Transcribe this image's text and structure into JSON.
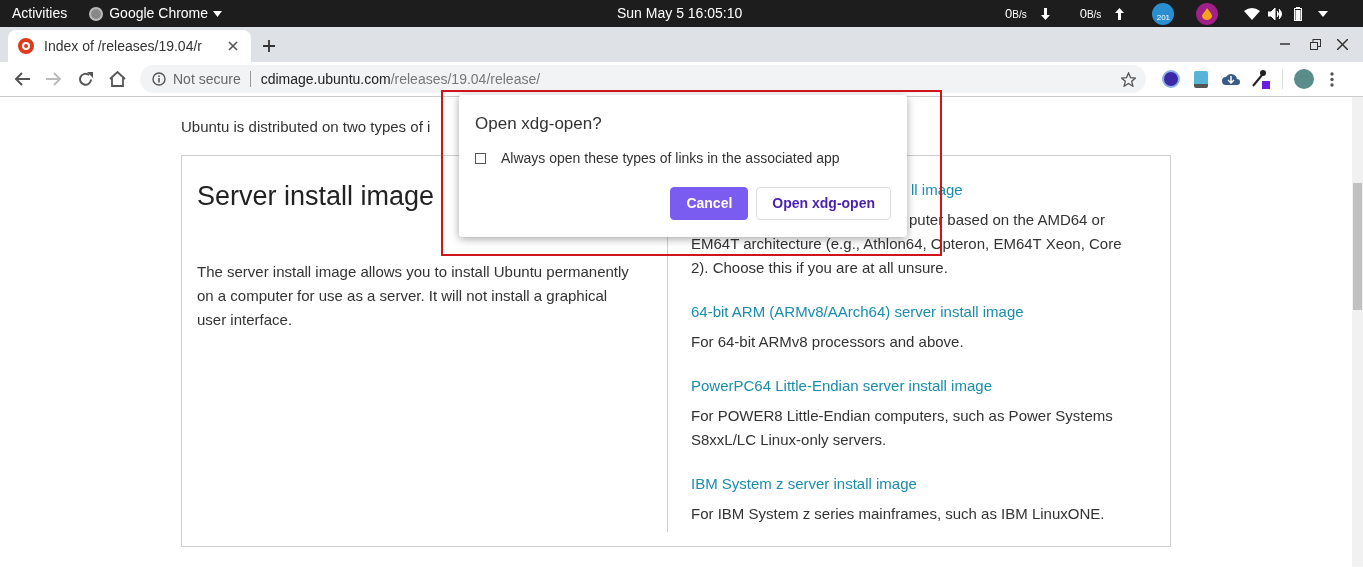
{
  "top_bar": {
    "activities": "Activities",
    "app_menu": "Google Chrome",
    "clock": "Sun May 5  16:05:10",
    "net_down": {
      "value": "0",
      "unit": "B/s"
    },
    "net_up": {
      "value": "0",
      "unit": "B/s"
    },
    "badge": "201"
  },
  "browser": {
    "tab": {
      "title": "Index of /releases/19.04/r",
      "selected": true
    },
    "address": {
      "security": "Not secure",
      "host": "cdimage.ubuntu.com",
      "path": "/releases/19.04/release/"
    }
  },
  "page": {
    "intro": "Ubuntu is distributed on two types of i",
    "card": {
      "heading": "Server install image",
      "description": "The server install image allows you to install Ubuntu permanently on a computer for use as a server. It will not install a graphical user interface.",
      "options": [
        {
          "link": "ll image",
          "lines": [
            "puter based on the AMD64 or",
            "EM64T architecture (e.g., Athlon64, Opteron, EM64T Xeon, Core",
            "2). Choose this if you are at all unsure."
          ],
          "partial": true
        },
        {
          "link": "64-bit ARM (ARMv8/AArch64) server install image",
          "lines": [
            "For 64-bit ARMv8 processors and above."
          ],
          "partial": false
        },
        {
          "link": "PowerPC64 Little-Endian server install image",
          "lines": [
            "For POWER8 Little-Endian computers, such as Power Systems",
            "S8xxL/LC Linux-only servers."
          ],
          "partial": false
        },
        {
          "link": "IBM System z server install image",
          "lines": [
            "For IBM System z series mainframes, such as IBM LinuxONE."
          ],
          "partial": false
        }
      ]
    }
  },
  "dialog": {
    "title": "Open xdg-open?",
    "checkbox": {
      "label": "Always open these types of links in the associated app",
      "checked": false
    },
    "buttons": [
      {
        "label": "Cancel",
        "kind": "primary"
      },
      {
        "label": "Open xdg-open",
        "kind": "secondary"
      }
    ]
  }
}
